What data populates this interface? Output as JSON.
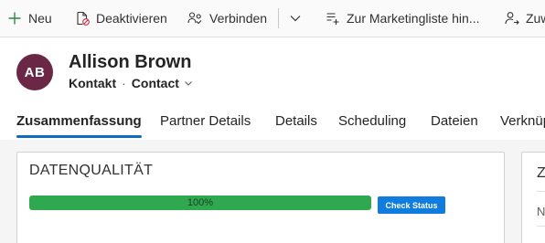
{
  "command_bar": {
    "new_label": "Neu",
    "deactivate_label": "Deaktivieren",
    "connect_label": "Verbinden",
    "marketing_list_label": "Zur Marketingliste hin...",
    "assign_label": "Zuweisen"
  },
  "record": {
    "initials": "AB",
    "name": "Allison Brown",
    "entity": "Kontakt",
    "separator": "·",
    "form": "Contact"
  },
  "tabs": [
    {
      "label": "Zusammenfassung",
      "active": true
    },
    {
      "label": "Partner Details",
      "active": false
    },
    {
      "label": "Details",
      "active": false
    },
    {
      "label": "Scheduling",
      "active": false
    },
    {
      "label": "Dateien",
      "active": false
    },
    {
      "label": "Verknüpft",
      "active": false
    }
  ],
  "data_quality": {
    "title": "DATENQUALITÄT",
    "progress_text": "100%",
    "progress_value": 1.0,
    "check_button_label": "Check Status"
  },
  "side_card": {
    "title": "Z",
    "field_label": "N"
  },
  "colors": {
    "avatar": "#6b2846",
    "accent": "#0f6cbd",
    "progress": "#2fa84f",
    "button": "#0f7cde",
    "new_icon": "#2f8a3c"
  },
  "icons": {
    "new": "plus-icon",
    "deactivate": "document-deactivate-icon",
    "connect": "people-connect-icon",
    "more": "chevron-down-icon",
    "marketing_list": "add-to-list-icon",
    "assign": "person-assign-icon",
    "form_selector": "chevron-down-icon"
  }
}
